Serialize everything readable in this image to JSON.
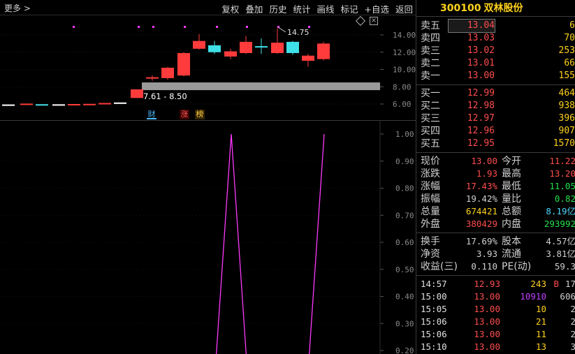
{
  "toolbar": {
    "more": "更多 >",
    "items": [
      "复权",
      "叠加",
      "历史",
      "统计",
      "画线",
      "标记",
      "+自选",
      "返回"
    ]
  },
  "kline": {
    "y_ticks": [
      "14.00",
      "12.00",
      "10.00",
      "8.00",
      "6.00"
    ],
    "max_label": "14.75",
    "range_label": "7.61 - 8.50",
    "tags": {
      "cai": "财",
      "zhang": "涨",
      "bang": "榜"
    }
  },
  "indicator": {
    "y_ticks": [
      "1.00",
      "0.90",
      "0.80",
      "0.70",
      "0.60",
      "0.50",
      "0.40",
      "0.30",
      "0.20"
    ]
  },
  "stock": {
    "code": "300100",
    "name": "双林股份"
  },
  "order_book": {
    "sells": [
      {
        "label": "卖五",
        "price": "13.04",
        "vol": "6"
      },
      {
        "label": "卖四",
        "price": "13.03",
        "vol": "70"
      },
      {
        "label": "卖三",
        "price": "13.02",
        "vol": "253"
      },
      {
        "label": "卖二",
        "price": "13.01",
        "vol": "66"
      },
      {
        "label": "卖一",
        "price": "13.00",
        "vol": "155"
      }
    ],
    "buys": [
      {
        "label": "买一",
        "price": "12.99",
        "vol": "464"
      },
      {
        "label": "买二",
        "price": "12.98",
        "vol": "938"
      },
      {
        "label": "买三",
        "price": "12.97",
        "vol": "396"
      },
      {
        "label": "买四",
        "price": "12.96",
        "vol": "907"
      },
      {
        "label": "买五",
        "price": "12.95",
        "vol": "1570"
      }
    ]
  },
  "stats": [
    {
      "l1": "现价",
      "v1": "13.00",
      "c1": "#ff4d4d",
      "l2": "今开",
      "v2": "11.22",
      "c2": "#ff4d4d"
    },
    {
      "l1": "涨跌",
      "v1": "1.93",
      "c1": "#ff4d4d",
      "l2": "最高",
      "v2": "13.20",
      "c2": "#ff4d4d"
    },
    {
      "l1": "涨幅",
      "v1": "17.43%",
      "c1": "#ff4d4d",
      "l2": "最低",
      "v2": "11.05",
      "c2": "#22e04a"
    },
    {
      "l1": "振幅",
      "v1": "19.42%",
      "c1": "#d0d0d0",
      "l2": "量比",
      "v2": "0.82",
      "c2": "#22e04a"
    },
    {
      "l1": "总量",
      "v1": "674421",
      "c1": "#ffd21e",
      "l2": "总额",
      "v2": "8.19亿",
      "c2": "#4fd8ff"
    },
    {
      "l1": "外盘",
      "v1": "380429",
      "c1": "#ff4d4d",
      "l2": "内盘",
      "v2": "293992",
      "c2": "#22e04a"
    }
  ],
  "stats2": [
    {
      "l1": "换手",
      "v1": "17.69%",
      "c1": "#d0d0d0",
      "l2": "股本",
      "v2": "4.57亿",
      "c2": "#d0d0d0"
    },
    {
      "l1": "净资",
      "v1": "3.93",
      "c1": "#d0d0d0",
      "l2": "流通",
      "v2": "3.81亿",
      "c2": "#d0d0d0"
    },
    {
      "l1": "收益(三)",
      "v1": "0.110",
      "c1": "#d0d0d0",
      "l2": "PE(动)",
      "v2": "59.3",
      "c2": "#d0d0d0"
    }
  ],
  "ticks": [
    {
      "time": "14:57",
      "price": "12.93",
      "vol": "243",
      "vc": "#ffd21e",
      "bs": "B",
      "bsc": "#ff4d4d",
      "n": "17"
    },
    {
      "time": "15:00",
      "price": "13.00",
      "vol": "10910",
      "vc": "#c040ff",
      "bs": "",
      "bsc": "#ff4d4d",
      "n": "606"
    },
    {
      "time": "15:05",
      "price": "13.00",
      "vol": "10",
      "vc": "#ffd21e",
      "bs": "",
      "bsc": "#ff4d4d",
      "n": "2"
    },
    {
      "time": "15:06",
      "price": "13.00",
      "vol": "21",
      "vc": "#ffd21e",
      "bs": "",
      "bsc": "#ff4d4d",
      "n": "2"
    },
    {
      "time": "15:06",
      "price": "13.00",
      "vol": "11",
      "vc": "#ffd21e",
      "bs": "",
      "bsc": "#ff4d4d",
      "n": "2"
    },
    {
      "time": "15:10",
      "price": "13.00",
      "vol": "13",
      "vc": "#ffd21e",
      "bs": "",
      "bsc": "#ff4d4d",
      "n": "3"
    }
  ],
  "colors": {
    "up": "#ff3b3b",
    "down": "#3fe0e8",
    "flat": "#ffffff",
    "indicator": "#ff38ff",
    "bg": "#000000"
  }
}
